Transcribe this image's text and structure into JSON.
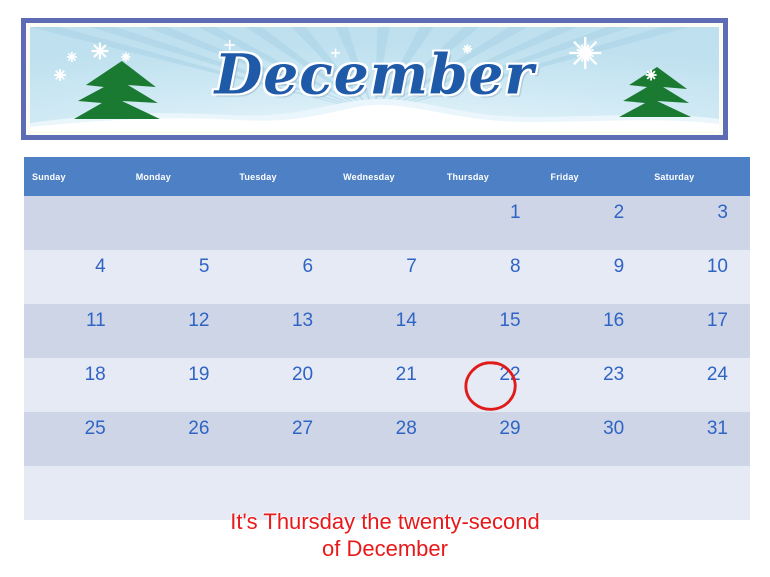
{
  "banner": {
    "title": "December",
    "icons": [
      "snowflake-icon",
      "pine-tree-icon",
      "sunburst-icon"
    ],
    "colors": {
      "frame": "#5d6cb4",
      "mat": "#fdfcf4",
      "sky": "#bfe0ef",
      "ray": "#d5ecf6",
      "snow": "#ffffff",
      "tree": "#1b7a31",
      "title_text": "#1f5aa8"
    }
  },
  "calendar": {
    "month": "December",
    "weekday_headers": [
      "Sunday",
      "Monday",
      "Tuesday",
      "Wednesday",
      "Thursday",
      "Friday",
      "Saturday"
    ],
    "weeks": [
      [
        "",
        "",
        "",
        "",
        "1",
        "2",
        "3"
      ],
      [
        "4",
        "5",
        "6",
        "7",
        "8",
        "9",
        "10"
      ],
      [
        "11",
        "12",
        "13",
        "14",
        "15",
        "16",
        "17"
      ],
      [
        "18",
        "19",
        "20",
        "21",
        "22",
        "23",
        "24"
      ],
      [
        "25",
        "26",
        "27",
        "28",
        "29",
        "30",
        "31"
      ],
      [
        "",
        "",
        "",
        "",
        "",
        "",
        ""
      ]
    ],
    "highlighted_day": "22",
    "highlight_marker": "red-circle-annotation",
    "colors": {
      "header_bg": "#4d80c4",
      "header_text": "#ffffff",
      "row_dark": "#ced5e7",
      "row_light": "#e6eaf4",
      "day_number": "#2f64c4",
      "marker": "#e01b1b"
    }
  },
  "caption": {
    "text": "It's Thursday the twenty-second\nof December",
    "color": "#e8191b"
  }
}
